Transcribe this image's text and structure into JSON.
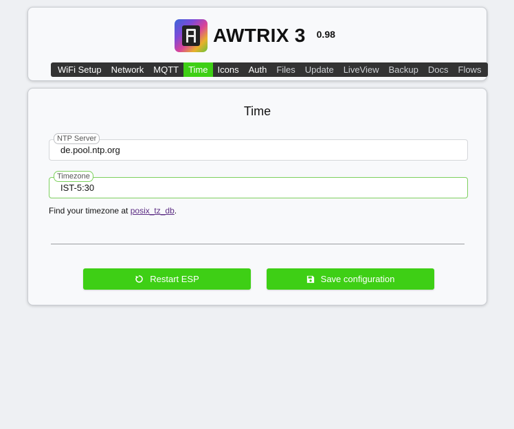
{
  "header": {
    "title": "AWTRIX 3",
    "version": "0.98",
    "logo_icon": "awtrix-logo-icon"
  },
  "nav": {
    "items": [
      {
        "label": "WiFi Setup"
      },
      {
        "label": "Network"
      },
      {
        "label": "MQTT"
      },
      {
        "label": "Time",
        "active": true
      },
      {
        "label": "Icons"
      },
      {
        "label": "Auth"
      },
      {
        "label": "Files"
      },
      {
        "label": "Update"
      },
      {
        "label": "LiveView"
      },
      {
        "label": "Backup"
      },
      {
        "label": "Docs"
      },
      {
        "label": "Flows"
      }
    ]
  },
  "main": {
    "title": "Time",
    "ntp": {
      "label": "NTP Server",
      "value": "de.pool.ntp.org"
    },
    "timezone": {
      "label": "Timezone",
      "value": "IST-5:30"
    },
    "hint": {
      "prefix": "Find your timezone at ",
      "link": "posix_tz_db",
      "suffix": "."
    },
    "restart_button": {
      "label": "Restart ESP",
      "icon": "restart-icon"
    },
    "save_button": {
      "label": "Save configuration",
      "icon": "floppy-disk-icon"
    }
  },
  "colors": {
    "accent": "#3ecf15",
    "nav_bg": "#333333",
    "link": "#5b2c83"
  }
}
